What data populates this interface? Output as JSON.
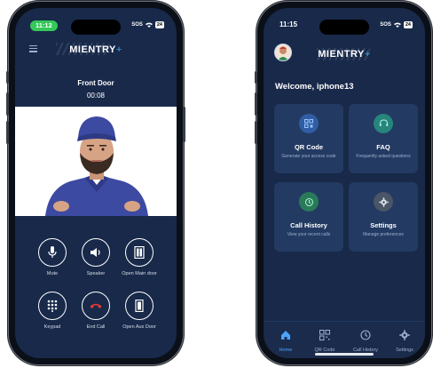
{
  "left_phone": {
    "status": {
      "time": "11:12",
      "sos": "SOS",
      "battery": "24"
    },
    "brand": {
      "name": "MIENTRY",
      "plus": "+"
    },
    "door_title": "Front Door",
    "call_timer": "00:08",
    "controls": [
      {
        "label": "Mute",
        "icon": "microphone-icon"
      },
      {
        "label": "Speaker",
        "icon": "speaker-icon"
      },
      {
        "label": "Open Main door",
        "icon": "door-icon"
      },
      {
        "label": "Keypad",
        "icon": "keypad-icon"
      },
      {
        "label": "End Call",
        "icon": "phone-hangup-icon"
      },
      {
        "label": "Open Aux Door",
        "icon": "door-icon"
      }
    ],
    "end_call_color": "#e53935"
  },
  "right_phone": {
    "status": {
      "time": "11:15",
      "sos": "SOS",
      "battery": "24"
    },
    "brand": {
      "name": "MIENTRY",
      "plus": "+"
    },
    "welcome": "Welcome, iphone13",
    "cards": [
      {
        "title": "QR Code",
        "subtitle": "Generate your access code",
        "icon": "qr-code-icon",
        "color": "#2f5ea5"
      },
      {
        "title": "FAQ",
        "subtitle": "Frequently asked questions",
        "icon": "headset-icon",
        "color": "#27857c"
      },
      {
        "title": "Call History",
        "subtitle": "View your recent calls",
        "icon": "history-icon",
        "color": "#2a7a5a"
      },
      {
        "title": "Settings",
        "subtitle": "Manage preferences",
        "icon": "gear-icon",
        "color": "#4a5568"
      }
    ],
    "tabs": [
      {
        "label": "Home",
        "icon": "home-icon",
        "active": true
      },
      {
        "label": "QR Code",
        "icon": "qr-code-icon",
        "active": false
      },
      {
        "label": "Call History",
        "icon": "history-icon",
        "active": false
      },
      {
        "label": "Settings",
        "icon": "gear-icon",
        "active": false
      }
    ]
  },
  "colors": {
    "screen_bg": "#18294a",
    "card_bg": "#233a62",
    "accent": "#3fa5e8",
    "status_green": "#34c759"
  }
}
